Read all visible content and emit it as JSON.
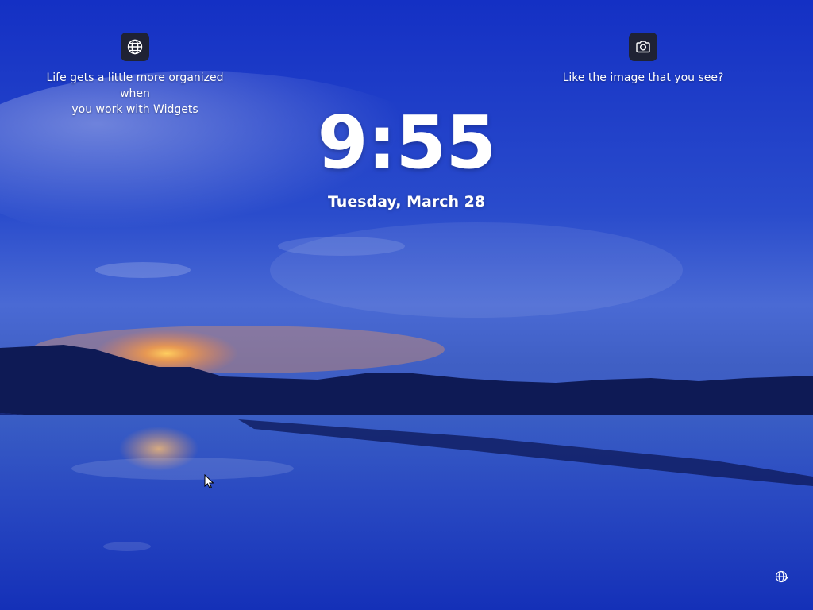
{
  "lock_screen": {
    "time": "9:55",
    "date": "Tuesday, March 28"
  },
  "widgets_tip": {
    "icon": "globe-icon",
    "text": "Life gets a little more organized when\nyou work with Widgets"
  },
  "spotlight_tip": {
    "icon": "camera-icon",
    "text": "Like the image that you see?"
  },
  "status": {
    "network_icon": "network-globe-icon"
  },
  "colors": {
    "sky": "#1f44c8",
    "widget_button_bg": "#202020",
    "text": "#ffffff"
  }
}
